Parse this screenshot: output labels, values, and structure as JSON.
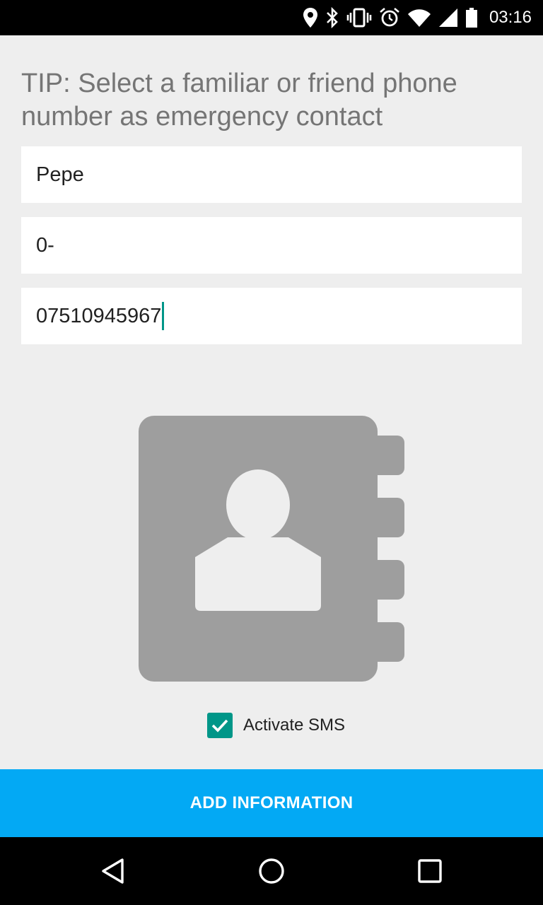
{
  "status_bar": {
    "time": "03:16",
    "icons": [
      "location-icon",
      "bluetooth-icon",
      "vibrate-icon",
      "alarm-icon",
      "wifi-icon",
      "signal-icon",
      "battery-icon"
    ]
  },
  "tip": {
    "text": "TIP: Select a familiar or friend phone number as emergency contact"
  },
  "form": {
    "name_value": "Pepe",
    "prefix_value": "0-",
    "phone_value": "07510945967"
  },
  "contact_picker": {
    "icon": "contact-book-icon"
  },
  "sms": {
    "label": "Activate SMS",
    "checked": true
  },
  "button": {
    "label": "ADD INFORMATION"
  },
  "nav_bar": {
    "icons": [
      "back-icon",
      "home-icon",
      "recents-icon"
    ]
  },
  "colors": {
    "accent": "#009688",
    "button": "#03a9f4",
    "background": "#eeeeee",
    "icon_gray": "#9e9e9e",
    "tip_text": "#757575"
  }
}
